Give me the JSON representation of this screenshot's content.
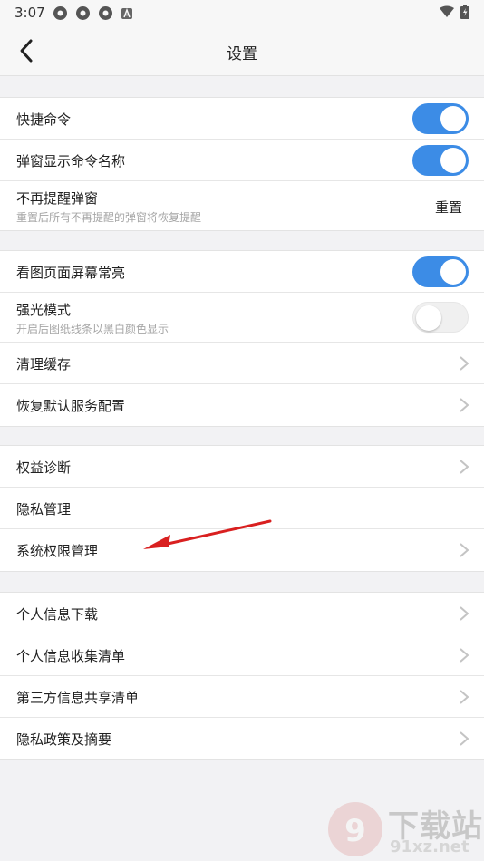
{
  "status_bar": {
    "time": "3:07",
    "notification_icons": [
      "app-icon",
      "app-icon",
      "app-icon",
      "a-icon"
    ],
    "right_icons": [
      "wifi-icon",
      "battery-icon"
    ]
  },
  "header": {
    "title": "设置"
  },
  "group1": {
    "shortcut_commands": {
      "label": "快捷命令",
      "toggle": "on"
    },
    "popup_show_command_name": {
      "label": "弹窗显示命令名称",
      "toggle": "on"
    },
    "no_remind_popup": {
      "label": "不再提醒弹窗",
      "sub": "重置后所有不再提醒的弹窗将恢复提醒",
      "action": "重置"
    }
  },
  "group2": {
    "screen_always_on": {
      "label": "看图页面屏幕常亮",
      "toggle": "on"
    },
    "high_light_mode": {
      "label": "强光模式",
      "sub": "开启后图纸线条以黑白颜色显示",
      "toggle": "off"
    },
    "clear_cache": {
      "label": "清理缓存"
    },
    "restore_default_service": {
      "label": "恢复默认服务配置"
    }
  },
  "group3": {
    "rights_diagnosis": {
      "label": "权益诊断"
    },
    "privacy_header": "隐私管理",
    "system_permissions": {
      "label": "系统权限管理"
    }
  },
  "group4": {
    "items": [
      {
        "label": "个人信息下载"
      },
      {
        "label": "个人信息收集清单"
      },
      {
        "label": "第三方信息共享清单"
      },
      {
        "label": "隐私政策及摘要"
      }
    ]
  },
  "watermark": {
    "text": "下载站",
    "url": "91xz.net"
  },
  "colors": {
    "toggle_on": "#3c8ce6",
    "arrow_annotation": "#d92020",
    "background": "#f2f2f4"
  }
}
